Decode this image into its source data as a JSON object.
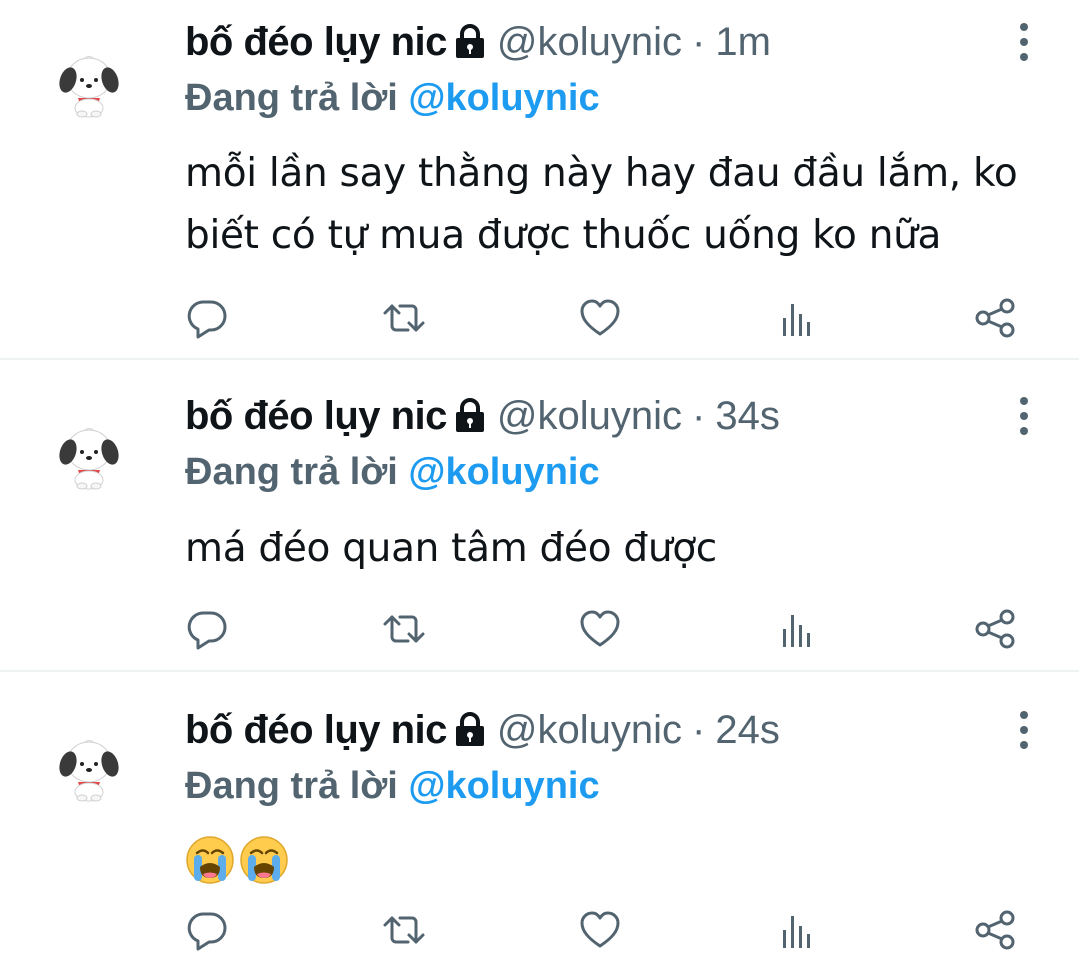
{
  "accent_color": "#1d9bf0",
  "muted_color": "#536471",
  "tweets": [
    {
      "name": "bố đéo lụy nic",
      "handle": "@koluynic",
      "separator": "·",
      "time": "1m",
      "replying_prefix": "Đang trả lời",
      "replying_to": "@koluynic",
      "text": "mỗi lần say thằng này hay đau đầu lắm, ko biết có tự mua được thuốc uống ko nữa",
      "icons": [
        "avatar-puppy",
        "lock-icon",
        "more-icon",
        "reply-icon",
        "retweet-icon",
        "like-icon",
        "analytics-icon",
        "share-icon"
      ]
    },
    {
      "name": "bố đéo lụy nic",
      "handle": "@koluynic",
      "separator": "·",
      "time": "34s",
      "replying_prefix": "Đang trả lời",
      "replying_to": "@koluynic",
      "text": "má đéo quan tâm đéo được",
      "icons": [
        "avatar-puppy",
        "lock-icon",
        "more-icon",
        "reply-icon",
        "retweet-icon",
        "like-icon",
        "analytics-icon",
        "share-icon"
      ]
    },
    {
      "name": "bố đéo lụy nic",
      "handle": "@koluynic",
      "separator": "·",
      "time": "24s",
      "replying_prefix": "Đang trả lời",
      "replying_to": "@koluynic",
      "emojis": [
        "loudly-crying-face",
        "loudly-crying-face"
      ],
      "icons": [
        "avatar-puppy",
        "lock-icon",
        "more-icon",
        "reply-icon",
        "retweet-icon",
        "like-icon",
        "analytics-icon",
        "share-icon"
      ]
    }
  ]
}
